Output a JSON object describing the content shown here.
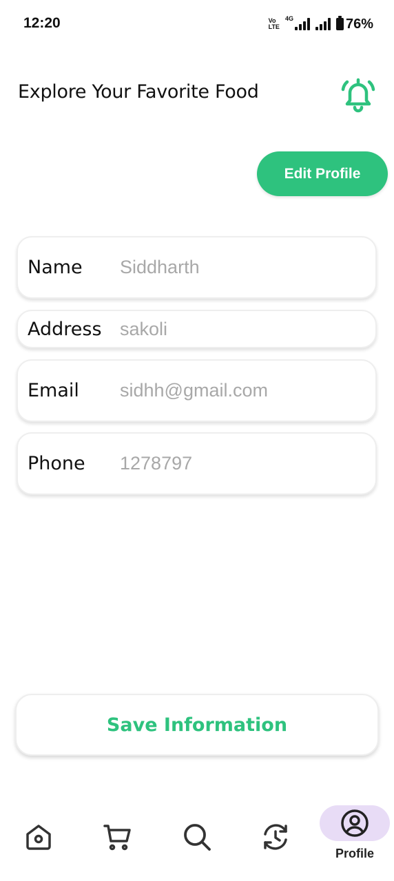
{
  "status_bar": {
    "time": "12:20",
    "volte_top": "Vo",
    "volte_bottom": "LTE",
    "network": "4G",
    "battery": "76%"
  },
  "header": {
    "title": "Explore Your Favorite Food",
    "bell_icon": "bell-icon",
    "accent_color": "#2ec27e"
  },
  "edit_button": {
    "label": "Edit Profile"
  },
  "fields": [
    {
      "label": "Name",
      "value": "Siddharth"
    },
    {
      "label": "Address",
      "value": "sakoli"
    },
    {
      "label": "Email",
      "value": "sidhh@gmail.com"
    },
    {
      "label": "Phone",
      "value": "1278797"
    }
  ],
  "save_button": {
    "label": "Save Information"
  },
  "bottom_nav": {
    "items": [
      {
        "icon": "home-icon"
      },
      {
        "icon": "cart-icon"
      },
      {
        "icon": "search-icon"
      },
      {
        "icon": "history-icon"
      },
      {
        "icon": "profile-icon",
        "label": "Profile",
        "active": true
      }
    ],
    "active_bg": "#e8dcf6"
  }
}
